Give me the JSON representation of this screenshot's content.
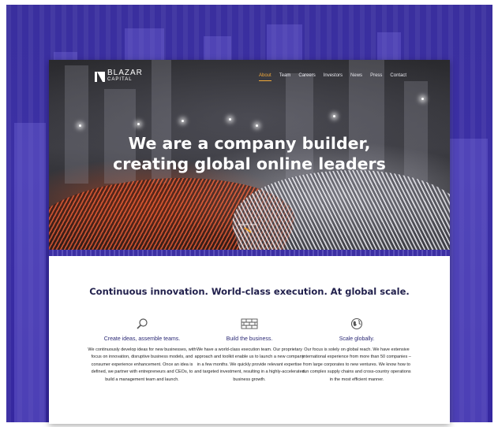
{
  "logo": {
    "name": "BLAZAR",
    "sub": "CAPITAL"
  },
  "nav": {
    "items": [
      {
        "label": "About"
      },
      {
        "label": "Team"
      },
      {
        "label": "Careers"
      },
      {
        "label": "Investors"
      },
      {
        "label": "News"
      },
      {
        "label": "Press"
      },
      {
        "label": "Contact"
      }
    ],
    "active_index": 0
  },
  "hero": {
    "headline_line1": "We are a company builder,",
    "headline_line2": "creating global online leaders",
    "explore_label": "Explore more"
  },
  "tagline": "Continuous innovation. World-class execution. At global scale.",
  "features": [
    {
      "icon": "magnifier-icon",
      "title": "Create ideas, assemble teams.",
      "text": "We continuously develop ideas for new businesses, with focus on innovation, disruptive business models, and consumer experience enhancement. Once an idea is defined, we partner with entrepreneurs and CEOs, to build a management team and launch."
    },
    {
      "icon": "brick-wall-icon",
      "title": "Build the business.",
      "text": "We have a world-class execution team. Our proprietary approach and toolkit enable us to launch a new company in a few months. We quickly provide relevant expertise and targeted investment, resulting in a highly-accelerated business growth."
    },
    {
      "icon": "globe-icon",
      "title": "Scale globally.",
      "text": "Our focus is solely on global reach. We have extensive international experience from more than 50 companies – from large corporates to new ventures. We know how to run complex supply chains and cross-country operations in the most efficient manner."
    }
  ],
  "colors": {
    "accent": "#f0a93a",
    "brand_blue": "#3c30a6",
    "heading": "#22214d"
  }
}
